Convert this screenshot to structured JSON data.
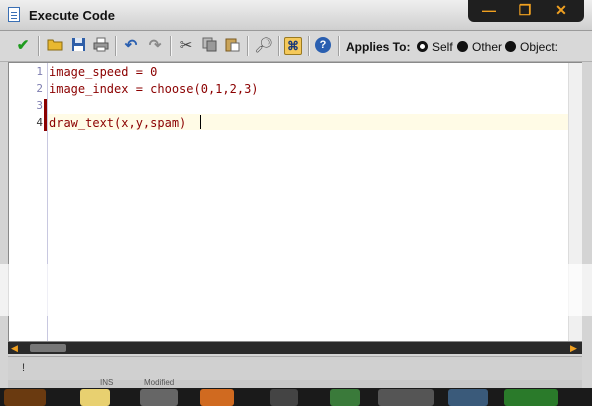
{
  "window": {
    "title": "Execute Code"
  },
  "window_buttons": {
    "minimize": "—",
    "maximize": "❐",
    "close": "✕"
  },
  "toolbar": {
    "applies_to_label": "Applies To:",
    "options": [
      {
        "label": "Self",
        "selected": true
      },
      {
        "label": "Other",
        "selected": false
      },
      {
        "label": "Object:",
        "selected": false
      }
    ]
  },
  "editor": {
    "lines": [
      {
        "number": "1",
        "text": "image_speed = 0"
      },
      {
        "number": "2",
        "text": "image_index = choose(0,1,2,3)"
      },
      {
        "number": "3",
        "text": ""
      },
      {
        "number": "4",
        "text": "draw_text(x,y,spam)"
      }
    ],
    "current_line": "4"
  },
  "status": {
    "mode": "INS",
    "modified": "Modified"
  },
  "colors": {
    "accent": "#f0a020",
    "code_text": "#8b0000",
    "line_numbers": "#7d7db0"
  }
}
